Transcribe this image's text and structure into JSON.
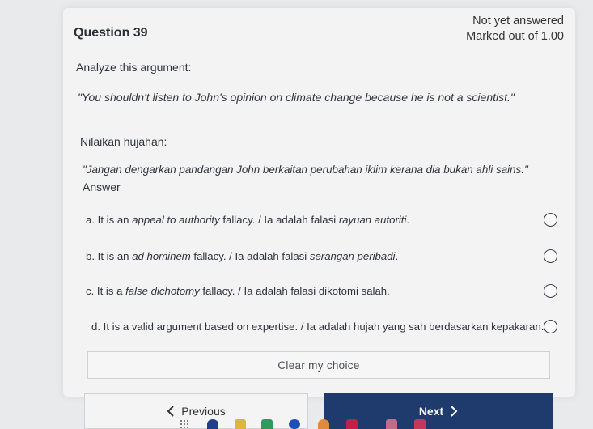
{
  "status": {
    "line1": "Not yet answered",
    "line2": "Marked out of 1.00"
  },
  "question": {
    "title": "Question 39",
    "prompt_en": "Analyze this argument:",
    "quote_en": "\"You shouldn't listen to John's opinion on climate change because he is not a scientist.\"",
    "prompt_ms": "Nilaikan hujahan:",
    "quote_ms": "\"Jangan dengarkan pandangan John berkaitan perubahan iklim kerana dia bukan ahli sains.\"",
    "answer_label": "Answer"
  },
  "options": [
    {
      "prefix": "a.  It is an ",
      "term": "appeal to authority",
      "middle": " fallacy. / Ia adalah falasi ",
      "term_ms": "rayuan autoriti",
      "suffix": "."
    },
    {
      "prefix": "b.  It is an ",
      "term": "ad hominem",
      "middle": " fallacy. / Ia adalah falasi ",
      "term_ms": "serangan peribadi",
      "suffix": "."
    },
    {
      "prefix": "c.  It is a ",
      "term": "false dichotomy",
      "middle": " fallacy. / Ia adalah falasi dikotomi salah.",
      "term_ms": "",
      "suffix": ""
    },
    {
      "prefix": "d.  It is a valid argument based on expertise. / Ia adalah hujah yang sah berdasarkan kepakaran.",
      "term": "",
      "middle": "",
      "term_ms": "",
      "suffix": ""
    }
  ],
  "buttons": {
    "clear": "Clear my choice",
    "previous": "Previous",
    "next": "Next"
  },
  "colors": {
    "primary": "#1f3b6e",
    "background": "#e9eaec"
  }
}
